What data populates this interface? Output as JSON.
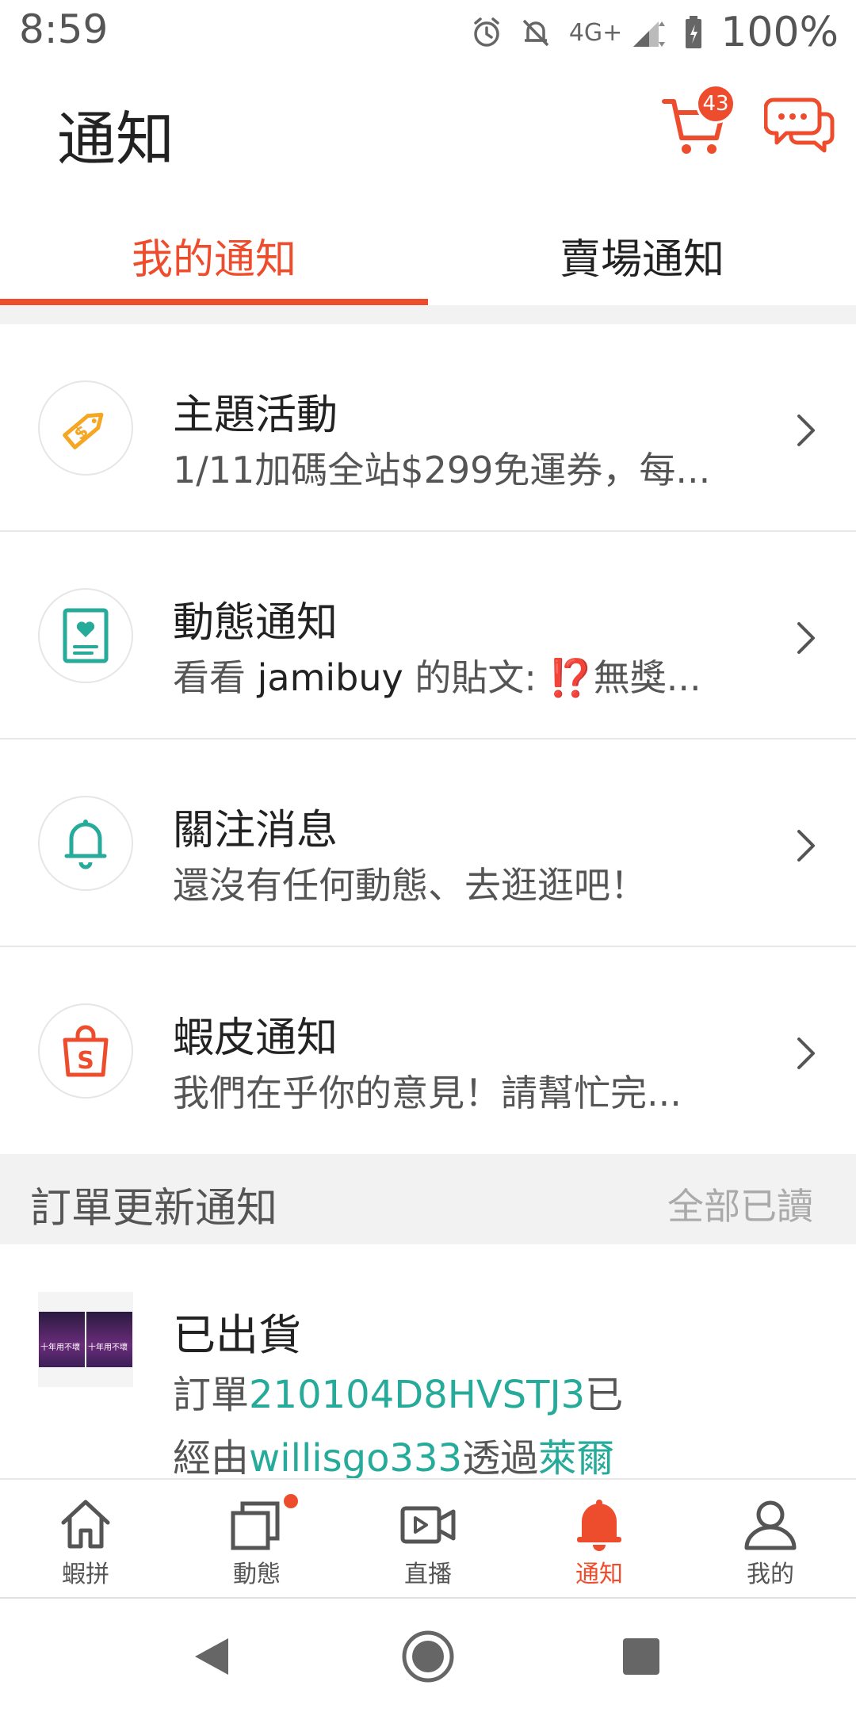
{
  "status_bar": {
    "time": "8:59",
    "network": "4G+",
    "battery": "100%"
  },
  "header": {
    "title": "通知",
    "cart_count": "43",
    "cart_icon": "cart-icon",
    "chat_icon": "chat-icon"
  },
  "tabs": [
    {
      "label": "我的通知",
      "active": true
    },
    {
      "label": "賣場通知",
      "active": false
    }
  ],
  "notifications": [
    {
      "title": "主題活動",
      "subtitle": "1/11加碼全站$299免運券，每...",
      "icon": "price-tag-icon",
      "icon_color": "#f5a623"
    },
    {
      "title": "動態通知",
      "subtitle_prefix": "看看 ",
      "subtitle_user": "jamibuy",
      "subtitle_suffix": " 的貼文: ⁉️無獎...",
      "icon": "feed-card-icon",
      "icon_color": "#26aa99"
    },
    {
      "title": "關注消息",
      "subtitle": "還沒有任何動態、去逛逛吧！",
      "icon": "bell-icon",
      "icon_color": "#26aa99"
    },
    {
      "title": "蝦皮通知",
      "subtitle": "我們在乎你的意見！請幫忙完...",
      "icon": "shopee-bag-icon",
      "icon_color": "#ee4d2d"
    }
  ],
  "order_section": {
    "title": "訂單更新通知",
    "mark_all_read": "全部已讀"
  },
  "order_item": {
    "thumb_text": "十年用不壞",
    "title": "已出貨",
    "line1_prefix": "訂單",
    "order_id": "210104D8HVSTJ3",
    "line1_suffix": "已",
    "line2_prefix": "經由",
    "seller": "willisgo333",
    "line2_mid": "透過",
    "carrier": "萊爾"
  },
  "bottom_nav": [
    {
      "label": "蝦拼",
      "icon": "home-icon",
      "active": false
    },
    {
      "label": "動態",
      "icon": "feed-icon",
      "active": false,
      "dot": true
    },
    {
      "label": "直播",
      "icon": "live-video-icon",
      "active": false
    },
    {
      "label": "通知",
      "icon": "bell-icon",
      "active": true
    },
    {
      "label": "我的",
      "icon": "profile-icon",
      "active": false
    }
  ],
  "colors": {
    "accent": "#ee4d2d",
    "teal": "#26aa99",
    "gold": "#f5a623"
  }
}
